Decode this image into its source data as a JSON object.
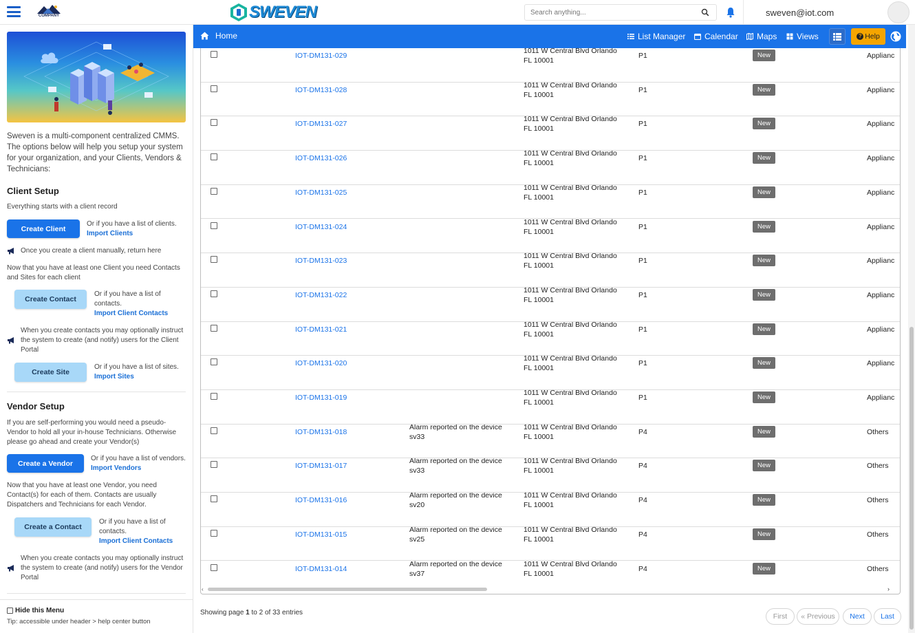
{
  "header": {
    "company_logo_text": "COMPANY",
    "brand_name": "SWEVEN",
    "search_placeholder": "Search anything...",
    "user_email": "sweven@iot.com"
  },
  "sidebar": {
    "intro": "Sweven is a multi-component centralized CMMS. The options below will help you setup your system for your organization, and your Clients, Vendors & Technicians:",
    "client_setup": {
      "title": "Client Setup",
      "subtitle": "Everything starts with a client record",
      "create_client_label": "Create Client",
      "or_clients_text": "Or if you have a list of clients.",
      "import_clients_label": "Import Clients",
      "return_note": "Once you create a client manually, return here",
      "contacts_sites_note": "Now that you have at least one Client you need Contacts and Sites for  each client",
      "create_contact_label": "Create Contact",
      "or_contacts_text": "Or if you have a list of contacts.",
      "import_client_contacts_label": "Import Client Contacts",
      "client_portal_note": "When you create contacts you may optionally instruct the system to create (and notify) users for the Client Portal",
      "create_site_label": "Create Site",
      "or_sites_text": "Or if you have a list of sites.",
      "import_sites_label": "Import Sites"
    },
    "vendor_setup": {
      "title": "Vendor Setup",
      "intro": "If you are self-performing you would need a pseudo-Vendor to hold all your in-house Technicians. Otherwise please go ahead and create your Vendor(s)",
      "create_vendor_label": "Create a Vendor",
      "or_vendors_text": "Or if you have a list of vendors.",
      "import_vendors_label": "Import Vendors",
      "contacts_note": "Now that you have at least one Vendor, you need Contact(s) for each of them. Contacts are usually Dispatchers and Technicians for each Vendor.",
      "create_contact_label": "Create a Contact",
      "or_contacts_text": "Or if you have a list of contacts.",
      "import_contacts_label": "Import Client Contacts",
      "vendor_portal_note": "When you create contacts you may optionally instruct the system to create (and notify) users for the Vendor Portal"
    },
    "hide_menu_label": "Hide this Menu",
    "tip": "Tip: accessible under header > help center button"
  },
  "navbar": {
    "home": "Home",
    "list_manager": "List Manager",
    "calendar": "Calendar",
    "maps": "Maps",
    "views": "Views",
    "help": "Help"
  },
  "table": {
    "rows": [
      {
        "id": "IOT-DM131-029",
        "desc": "",
        "addr": "1011 W Central Blvd Orlando FL 10001",
        "priority": "P1",
        "status": "New",
        "category": "Applianc"
      },
      {
        "id": "IOT-DM131-028",
        "desc": "",
        "addr": "1011 W Central Blvd Orlando FL 10001",
        "priority": "P1",
        "status": "New",
        "category": "Applianc"
      },
      {
        "id": "IOT-DM131-027",
        "desc": "",
        "addr": "1011 W Central Blvd Orlando FL 10001",
        "priority": "P1",
        "status": "New",
        "category": "Applianc"
      },
      {
        "id": "IOT-DM131-026",
        "desc": "",
        "addr": "1011 W Central Blvd Orlando FL 10001",
        "priority": "P1",
        "status": "New",
        "category": "Applianc"
      },
      {
        "id": "IOT-DM131-025",
        "desc": "",
        "addr": "1011 W Central Blvd Orlando FL 10001",
        "priority": "P1",
        "status": "New",
        "category": "Applianc"
      },
      {
        "id": "IOT-DM131-024",
        "desc": "",
        "addr": "1011 W Central Blvd Orlando FL 10001",
        "priority": "P1",
        "status": "New",
        "category": "Applianc"
      },
      {
        "id": "IOT-DM131-023",
        "desc": "",
        "addr": "1011 W Central Blvd Orlando FL 10001",
        "priority": "P1",
        "status": "New",
        "category": "Applianc"
      },
      {
        "id": "IOT-DM131-022",
        "desc": "",
        "addr": "1011 W Central Blvd Orlando FL 10001",
        "priority": "P1",
        "status": "New",
        "category": "Applianc"
      },
      {
        "id": "IOT-DM131-021",
        "desc": "",
        "addr": "1011 W Central Blvd Orlando FL 10001",
        "priority": "P1",
        "status": "New",
        "category": "Applianc"
      },
      {
        "id": "IOT-DM131-020",
        "desc": "",
        "addr": "1011 W Central Blvd Orlando FL 10001",
        "priority": "P1",
        "status": "New",
        "category": "Applianc"
      },
      {
        "id": "IOT-DM131-019",
        "desc": "",
        "addr": "1011 W Central Blvd Orlando FL 10001",
        "priority": "P1",
        "status": "New",
        "category": "Applianc"
      },
      {
        "id": "IOT-DM131-018",
        "desc": "Alarm reported on the device sv33",
        "addr": "1011 W Central Blvd Orlando FL 10001",
        "priority": "P4",
        "status": "New",
        "category": "Others"
      },
      {
        "id": "IOT-DM131-017",
        "desc": "Alarm reported on the device sv33",
        "addr": "1011 W Central Blvd Orlando FL 10001",
        "priority": "P4",
        "status": "New",
        "category": "Others"
      },
      {
        "id": "IOT-DM131-016",
        "desc": "Alarm reported on the device sv20",
        "addr": "1011 W Central Blvd Orlando FL 10001",
        "priority": "P4",
        "status": "New",
        "category": "Others"
      },
      {
        "id": "IOT-DM131-015",
        "desc": "Alarm reported on the device sv25",
        "addr": "1011 W Central Blvd Orlando FL 10001",
        "priority": "P4",
        "status": "New",
        "category": "Others"
      },
      {
        "id": "IOT-DM131-014",
        "desc": "Alarm reported on the device sv37",
        "addr": "1011 W Central Blvd Orlando FL 10001",
        "priority": "P4",
        "status": "New",
        "category": "Others"
      }
    ]
  },
  "footer": {
    "showing_prefix": "Showing page ",
    "page": "1",
    "showing_middle": " to ",
    "pages": "2",
    "showing_suffix": " of 33 entries",
    "first": "First",
    "previous": "« Previous",
    "next": "Next",
    "last": "Last"
  },
  "colors": {
    "primary": "#1a73e8",
    "help_button": "#f5a500",
    "status_badge": "#6e6e6e",
    "light_button": "#a8d8f8"
  }
}
